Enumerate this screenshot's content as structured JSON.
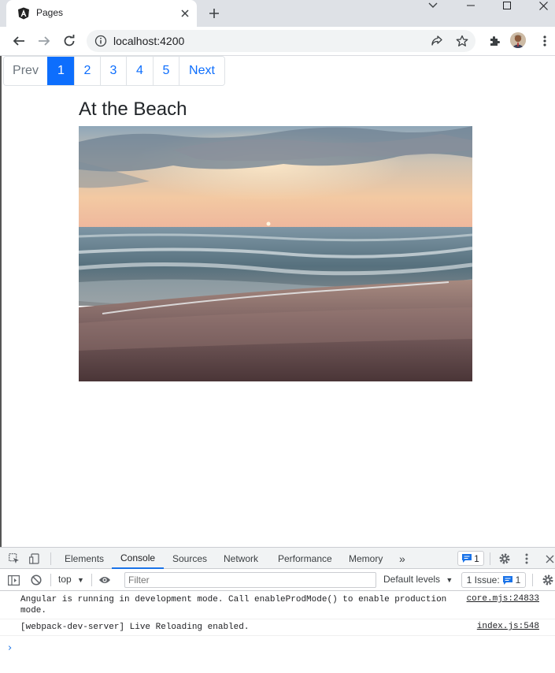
{
  "browser": {
    "tab_title": "Pages",
    "url": "localhost:4200"
  },
  "pagination": {
    "items": [
      {
        "label": "Prev",
        "state": "disabled"
      },
      {
        "label": "1",
        "state": "active"
      },
      {
        "label": "2",
        "state": "normal"
      },
      {
        "label": "3",
        "state": "normal"
      },
      {
        "label": "4",
        "state": "normal"
      },
      {
        "label": "5",
        "state": "normal"
      },
      {
        "label": "Next",
        "state": "normal"
      }
    ]
  },
  "content": {
    "heading": "At the Beach"
  },
  "devtools": {
    "tabs": [
      "Elements",
      "Console",
      "Sources",
      "Network",
      "Performance",
      "Memory"
    ],
    "active_tab": "Console",
    "more_tabs": "»",
    "message_count": "1",
    "context": "top",
    "filter_placeholder": "Filter",
    "levels": "Default levels",
    "issues_label": "1 Issue:",
    "issues_count": "1",
    "logs": [
      {
        "text": "Angular is running in development mode. Call enableProdMode() to enable production mode.",
        "source": "core.mjs:24833"
      },
      {
        "text": "[webpack-dev-server] Live Reloading enabled.",
        "source": "index.js:548"
      }
    ],
    "prompt": "›"
  },
  "colors": {
    "accent": "#0d6efd",
    "devtools_accent": "#1a73e8"
  }
}
